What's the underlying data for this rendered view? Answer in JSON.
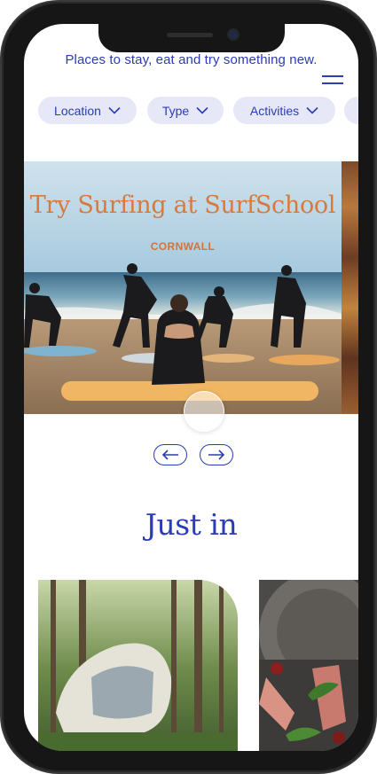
{
  "header": {
    "tagline": "Places to stay, eat and try something new."
  },
  "filters": [
    {
      "label": "Location"
    },
    {
      "label": "Type"
    },
    {
      "label": "Activities"
    }
  ],
  "hero": {
    "title": "Try Surfing at SurfSchool",
    "subtitle": "CORNWALL"
  },
  "section": {
    "title": "Just in"
  },
  "colors": {
    "accent": "#2b3cb4",
    "pill_bg": "#e6e8f7",
    "hero_text": "#d77a3c"
  },
  "icons": {
    "menu": "hamburger-menu-icon",
    "filter": "chevron-down-icon",
    "prev": "arrow-left-icon",
    "next": "arrow-right-icon"
  }
}
